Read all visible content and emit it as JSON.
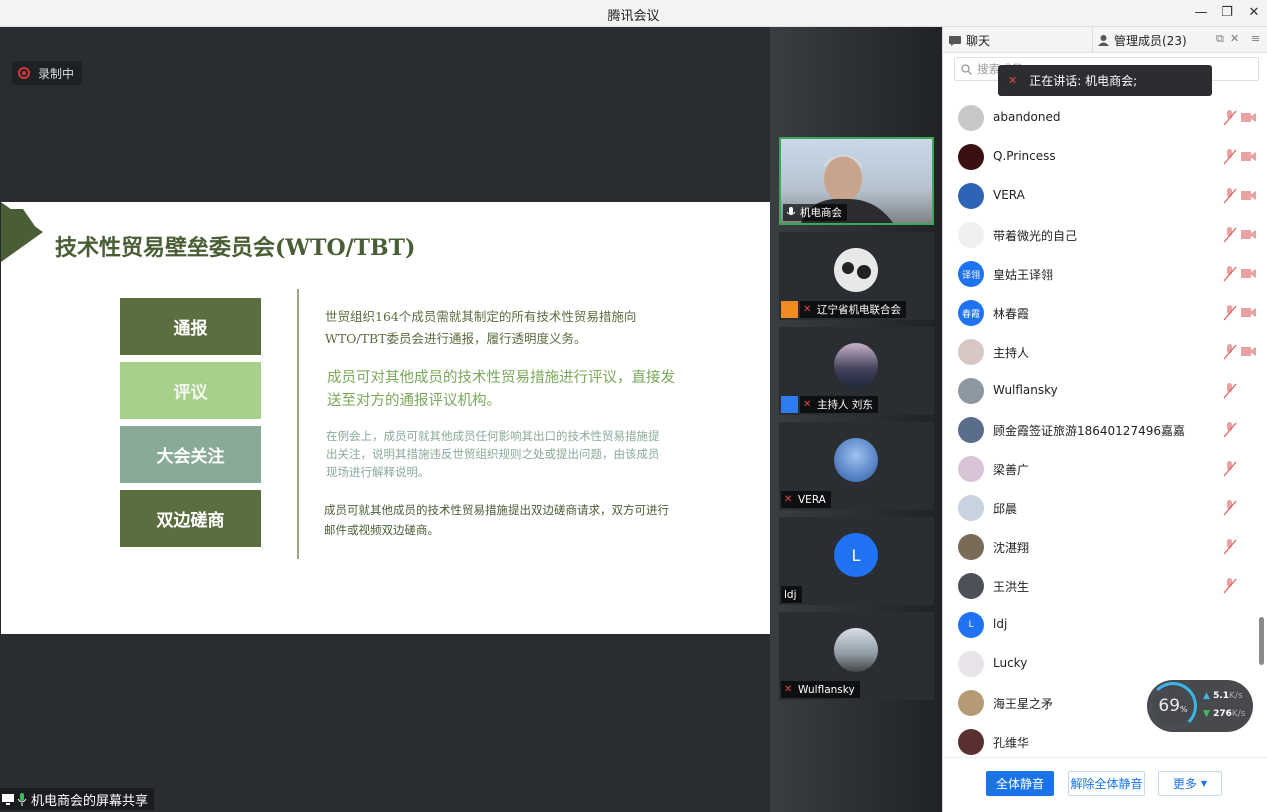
{
  "window": {
    "title": "腾讯会议"
  },
  "recording": {
    "label": "录制中"
  },
  "slide": {
    "title": "技术性贸易壁垒委员会(WTO/TBT)",
    "boxes": [
      "通报",
      "评议",
      "大会关注",
      "双边磋商"
    ],
    "desc1": "世贸组织164个成员需就其制定的所有技术性贸易措施向WTO/TBT委员会进行通报，履行透明度义务。",
    "desc2": "成员可对其他成员的技术性贸易措施进行评议，直接发送至对方的通报评议机构。",
    "desc3": "在例会上，成员可就其他成员任何影响其出口的技术性贸易措施提出关注，说明其措施违反世贸组织规则之处或提出问题，由该成员现场进行解释说明。",
    "desc4": "成员可就其他成员的技术性贸易措施提出双边磋商请求，双方可进行邮件或视频双边磋商。"
  },
  "share": {
    "label": "机电商会的屏幕共享"
  },
  "video_tiles": [
    {
      "name": "机电商会"
    },
    {
      "name": "辽宁省机电联合会"
    },
    {
      "name": "主持人 刘东"
    },
    {
      "name": "VERA"
    },
    {
      "name": "ldj",
      "avatar_letter": "L"
    },
    {
      "name": "Wulflansky"
    }
  ],
  "panel": {
    "tab_chat": "聊天",
    "tab_members": "管理成员(23)",
    "search_placeholder": "搜索成员",
    "speaking": "正在讲话: 机电商会;",
    "members": [
      {
        "name": "abandoned",
        "mic": "muted",
        "cam": true
      },
      {
        "name": "Q.Princess",
        "mic": "muted",
        "cam": true
      },
      {
        "name": "VERA",
        "mic": "muted",
        "cam": true
      },
      {
        "name": "带着微光的自己",
        "mic": "muted",
        "cam": true
      },
      {
        "name": "皇姑王译翎",
        "mic": "muted",
        "cam": true,
        "avatar_text": "译翎"
      },
      {
        "name": "林春霞",
        "mic": "muted",
        "cam": true,
        "avatar_text": "春霞"
      },
      {
        "name": "主持人",
        "mic": "muted",
        "cam": true
      },
      {
        "name": "Wulflansky",
        "mic": "muted",
        "cam": false
      },
      {
        "name": "顾金霞签证旅游18640127496嘉嘉",
        "mic": "muted",
        "cam": false
      },
      {
        "name": "梁善广",
        "mic": "muted",
        "cam": false
      },
      {
        "name": "邱晨",
        "mic": "muted",
        "cam": false
      },
      {
        "name": "沈湛翔",
        "mic": "muted",
        "cam": false
      },
      {
        "name": "王洪生",
        "mic": "muted",
        "cam": false
      },
      {
        "name": "ldj",
        "mic": "none",
        "cam": false,
        "avatar_text": "L"
      },
      {
        "name": "Lucky",
        "mic": "none",
        "cam": false
      },
      {
        "name": "海王星之矛",
        "mic": "none",
        "cam": false
      },
      {
        "name": "孔维华",
        "mic": "none",
        "cam": false
      }
    ],
    "buttons": {
      "mute_all": "全体静音",
      "unmute_all": "解除全体静音",
      "more": "更多"
    }
  },
  "net": {
    "percent": "69",
    "percent_unit": "%",
    "up": "5.1",
    "down": "276",
    "unit": "K/s"
  },
  "colors": {
    "accent": "#1a74e8",
    "slide_green": "#5b6e40",
    "active_border": "#3aa757",
    "mute_red": "#e04848"
  }
}
